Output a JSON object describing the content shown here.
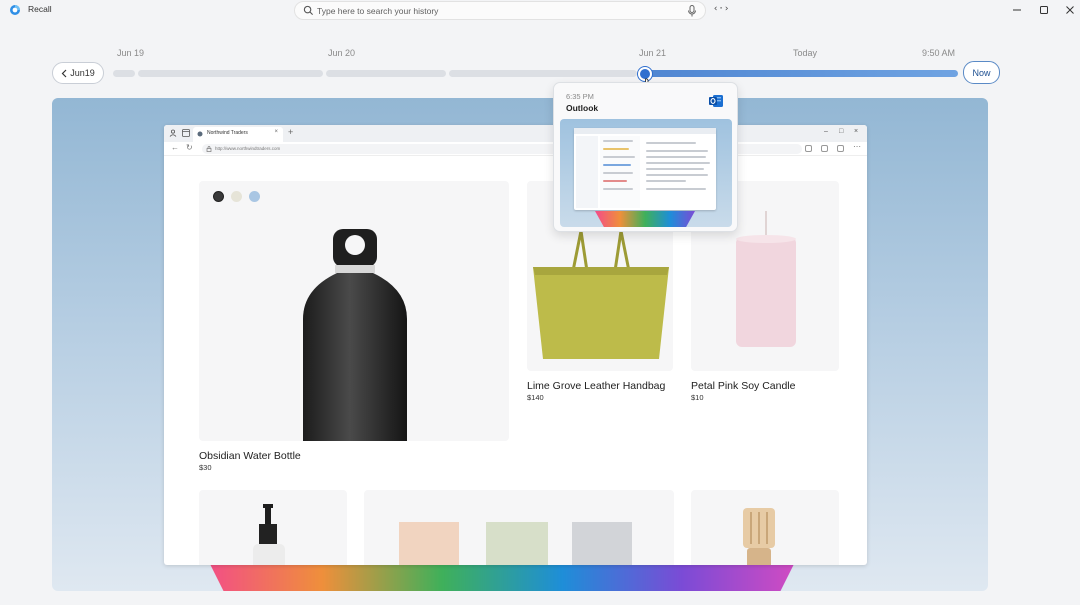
{
  "app": {
    "title": "Recall"
  },
  "search": {
    "placeholder": "Type here to search your history"
  },
  "toolbar": {
    "code_label": "‹·›"
  },
  "timeline": {
    "dates": [
      "Jun 19",
      "Jun 20",
      "Jun 21",
      "Today",
      "9:50 AM"
    ],
    "back_label": "Jun19",
    "now_label": "Now"
  },
  "popup": {
    "time": "6:35 PM",
    "app": "Outlook"
  },
  "browser": {
    "tab_title": "Northwind Traders",
    "url": "http://www.northwindtraders.com",
    "tab_close": "×",
    "new_tab": "+"
  },
  "products": [
    {
      "name": "Obsidian  Water Bottle",
      "price": "$30"
    },
    {
      "name": "Lime Grove Leather Handbag",
      "price": "$140"
    },
    {
      "name": "Petal Pink Soy Candle",
      "price": "$10"
    }
  ],
  "colors": {
    "accent": "#2f6fcf",
    "swatches": [
      "#3a3a3a",
      "#e6e4d8",
      "#a9c6e3"
    ]
  },
  "icons": [
    "recall-logo-icon",
    "search-icon",
    "microphone-icon",
    "minimize-icon",
    "maximize-icon",
    "close-icon",
    "chevron-left-icon",
    "outlook-icon",
    "pointer-cursor-icon"
  ]
}
